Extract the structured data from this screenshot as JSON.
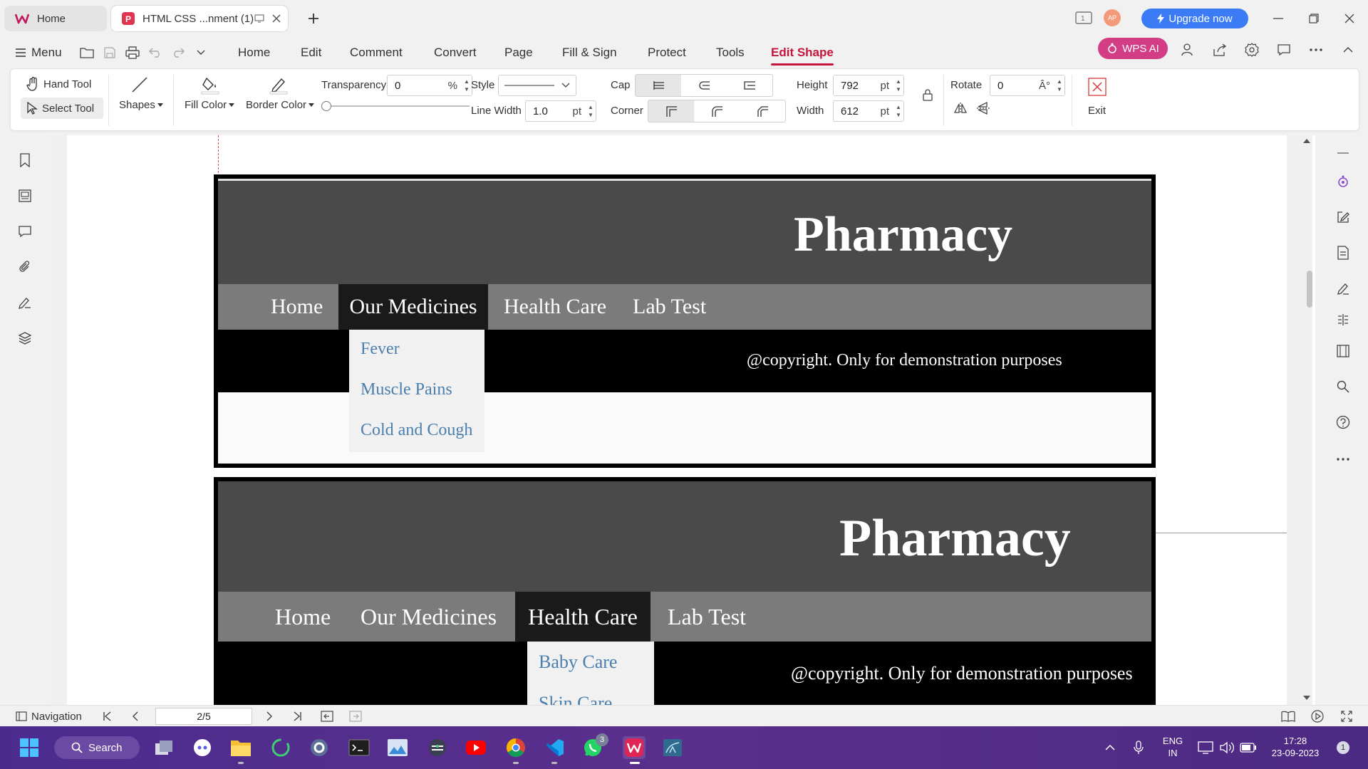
{
  "tabs": [
    {
      "label": "Home"
    },
    {
      "label": "HTML CSS ...nment (1)"
    }
  ],
  "titlebar": {
    "upgrade_label": "Upgrade now",
    "avatar_initials": "AP"
  },
  "menubar": {
    "menu_label": "Menu",
    "items": [
      "Home",
      "Edit",
      "Comment",
      "Convert",
      "Page",
      "Fill & Sign",
      "Protect",
      "Tools",
      "Edit Shape"
    ],
    "active": "Edit Shape",
    "wps_ai_label": "WPS AI"
  },
  "ribbon": {
    "hand_tool": "Hand Tool",
    "select_tool": "Select Tool",
    "shapes": "Shapes",
    "fill_color": "Fill Color",
    "border_color": "Border Color",
    "transparency_label": "Transparency",
    "transparency_value": "0",
    "transparency_unit": "%",
    "transparency_slider_level": 0,
    "style_label": "Style",
    "line_width_label": "Line Width",
    "line_width_value": "1.0",
    "line_width_unit": "pt",
    "cap_label": "Cap",
    "corner_label": "Corner",
    "height_label": "Height",
    "height_value": "792",
    "height_unit": "pt",
    "width_label": "Width",
    "width_value": "612",
    "width_unit": "pt",
    "rotate_label": "Rotate",
    "rotate_value": "0",
    "rotate_unit": "Â°",
    "exit_label": "Exit"
  },
  "document": {
    "page1": {
      "title": "Pharmacy",
      "nav": [
        "Home",
        "Our Medicines",
        "Health Care",
        "Lab Test"
      ],
      "selected_nav": "Our Medicines",
      "dropdown": [
        "Fever",
        "Muscle Pains",
        "Cold and Cough"
      ],
      "copyright": "@copyright. Only for demonstration purposes"
    },
    "page2": {
      "title": "Pharmacy",
      "nav": [
        "Home",
        "Our Medicines",
        "Health Care",
        "Lab Test"
      ],
      "selected_nav": "Health Care",
      "dropdown": [
        "Baby Care",
        "Skin Care"
      ],
      "copyright": "@copyright. Only for demonstration purposes"
    }
  },
  "statusbar": {
    "navigation_label": "Navigation",
    "page_indicator": "2/5"
  },
  "taskbar": {
    "search_label": "Search",
    "whatsapp_badge": "3",
    "language": "ENG",
    "region": "IN",
    "time": "17:28",
    "date": "23-09-2023",
    "notification_count": "1"
  },
  "colors": {
    "accent": "#c8143c",
    "upgrade": "#3b7cf6",
    "wps_ai": "#d33d86",
    "header_bg": "#4a4a4a",
    "nav_bg": "#7b7b7b",
    "link": "#4a7fae"
  }
}
